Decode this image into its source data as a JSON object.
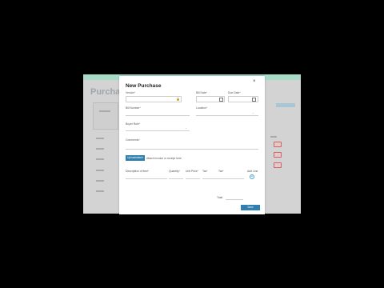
{
  "background_page": {
    "title": "Purchase"
  },
  "modal": {
    "title": "New Purchase",
    "close_label": "×",
    "fields": {
      "vendor": {
        "label": "Vendor",
        "req": "*"
      },
      "bill_date": {
        "label": "Bill Date",
        "req": "*"
      },
      "due_date": {
        "label": "Due Date",
        "req": "*"
      },
      "bill_number": {
        "label": "Bill Number",
        "req": "*"
      },
      "location": {
        "label": "Location",
        "req": "*"
      },
      "buyer": {
        "label": "Buyer Rule",
        "req": "*"
      },
      "comments": {
        "label": "Comments",
        "req": "*"
      }
    },
    "attach_button": "Upload/attach",
    "attach_link": "Attach invoice or receipt here",
    "items": {
      "description": {
        "label": "Description of item",
        "req": "*"
      },
      "quantity": {
        "label": "Quantity",
        "req": "*"
      },
      "unit_price": {
        "label": "Unit Price",
        "req": "*"
      },
      "tax": {
        "label": "Tax",
        "req": "*"
      },
      "add": {
        "label": "Add Line",
        "icon": "+"
      }
    },
    "total_label": "Total",
    "submit_label": "Save"
  },
  "colors": {
    "accent": "#2f7fb0",
    "header_bar": "#a8dcc6",
    "required": "#d9534f"
  },
  "icons": [
    "calendar-icon",
    "lock-icon",
    "close-icon",
    "add-icon",
    "chevron-down-icon"
  ]
}
